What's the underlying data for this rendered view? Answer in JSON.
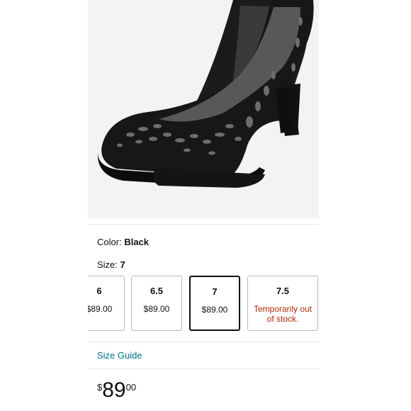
{
  "product": {
    "image_alt": "Black suede laser-cut platform pumps"
  },
  "variation": {
    "color_label": "Color:",
    "color_value": "Black",
    "size_label": "Size:",
    "size_value": "7"
  },
  "sizes": [
    {
      "size": "6",
      "price": "$89.00"
    },
    {
      "size": "6.5",
      "price": "$89.00"
    },
    {
      "size": "7",
      "price": "$89.00"
    },
    {
      "size": "7.5",
      "status": "Temporarily out of stock."
    }
  ],
  "links": {
    "size_guide": "Size Guide"
  },
  "price": {
    "symbol": "$",
    "whole": "89",
    "fraction": "00"
  },
  "colors": {
    "link": "#007185",
    "out_of_stock": "#b12704",
    "selected_border": "#0f1111"
  }
}
